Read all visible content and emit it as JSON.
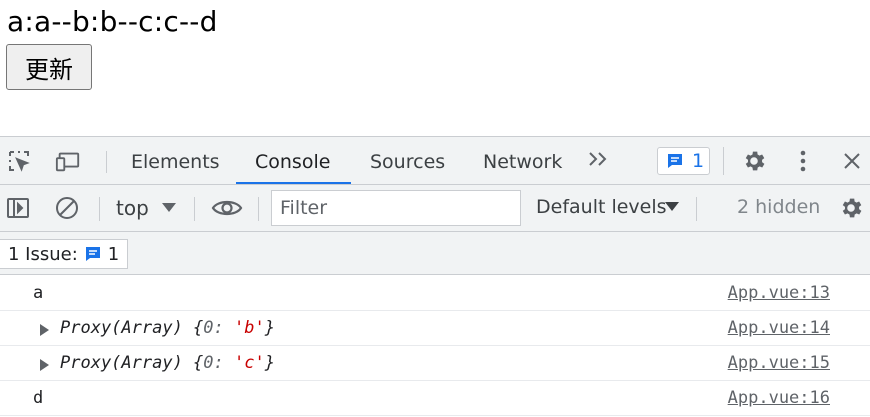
{
  "page": {
    "text": "a:a--b:b--c:c--d",
    "button_label": "更新"
  },
  "devtools": {
    "tabs": [
      {
        "label": "Elements"
      },
      {
        "label": "Console"
      },
      {
        "label": "Sources"
      },
      {
        "label": "Network"
      }
    ],
    "messages_count": "1",
    "toolbar": {
      "context": "top",
      "filter_placeholder": "Filter",
      "levels": "Default levels",
      "hidden": "2 hidden"
    },
    "issues": {
      "label": "1 Issue:",
      "count": "1"
    },
    "console_rows": [
      {
        "text": "a",
        "source": "App.vue:13"
      },
      {
        "prefix": "Proxy(Array) {",
        "key": "0:",
        "value": "'b'",
        "suffix": "}",
        "source": "App.vue:14"
      },
      {
        "prefix": "Proxy(Array) {",
        "key": "0:",
        "value": "'c'",
        "suffix": "}",
        "source": "App.vue:15"
      },
      {
        "text": "d",
        "source": "App.vue:16"
      }
    ]
  },
  "colors": {
    "accent": "#1a73e8",
    "string": "#c80000"
  }
}
